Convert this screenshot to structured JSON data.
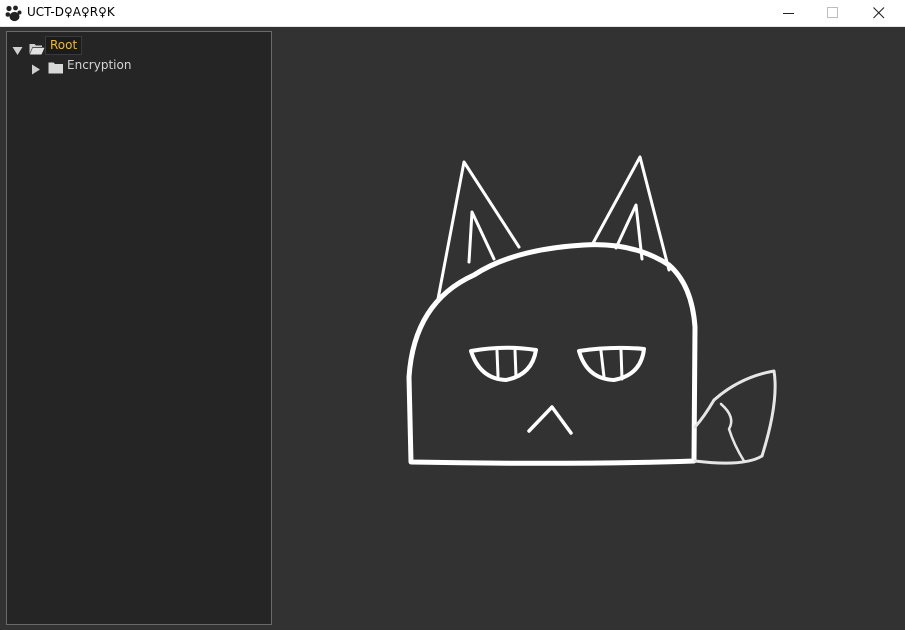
{
  "window": {
    "title": "UCT-D♀A♀R♀K",
    "minimize_icon": "minimize-icon",
    "maximize_icon": "maximize-icon",
    "close_icon": "close-icon",
    "app_icon": "paw-icon"
  },
  "tree": {
    "root": {
      "label": "Root",
      "expanded": true,
      "icon": "folder-open-icon"
    },
    "children": [
      {
        "label": "Encryption",
        "expanded": false,
        "icon": "folder-icon"
      }
    ]
  },
  "colors": {
    "background": "#323232",
    "tree_background": "#252525",
    "selected_label": "#f2b733",
    "tree_text": "#d3d3d3",
    "drawing_stroke": "#ffffff"
  },
  "canvas": {
    "content": "cat-drawing-icon"
  }
}
